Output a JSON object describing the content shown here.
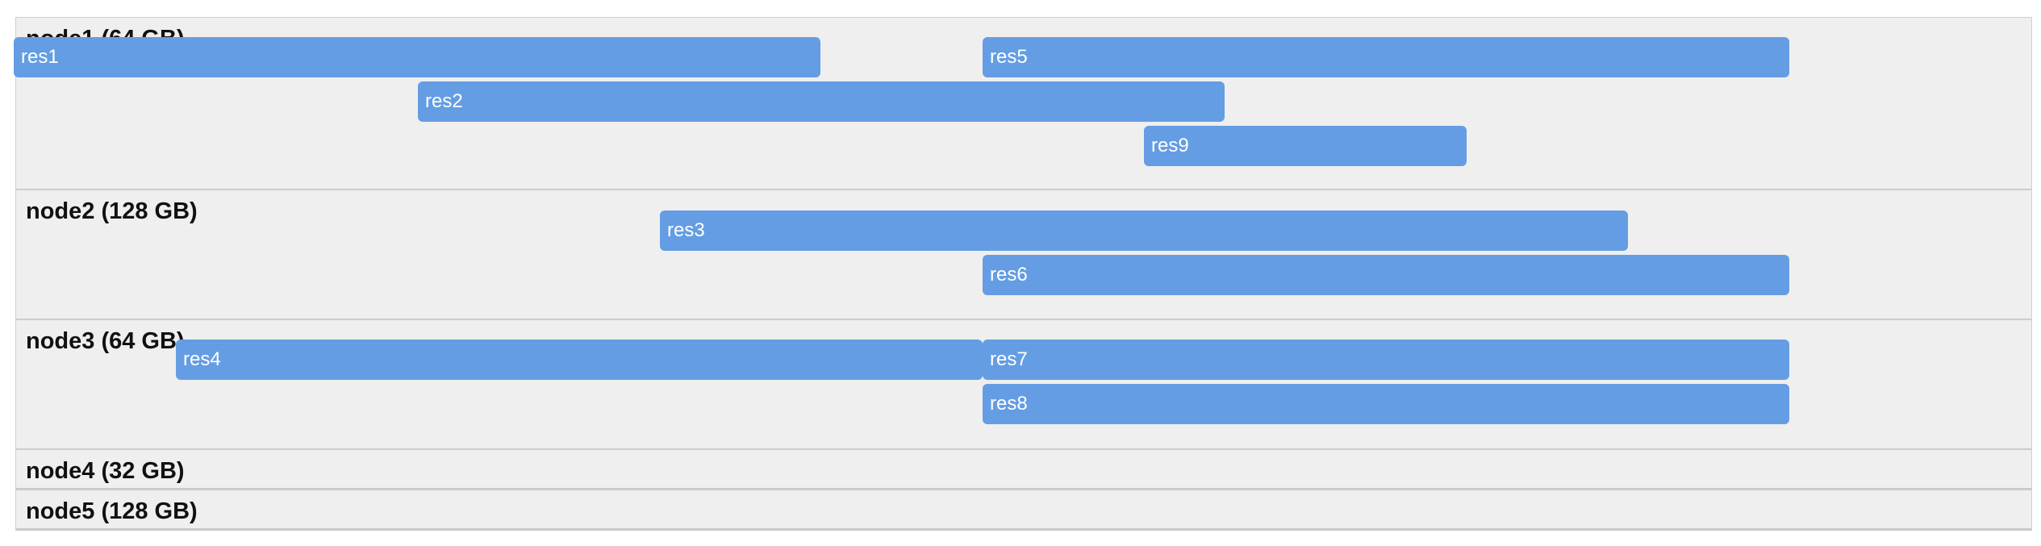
{
  "timeline": {
    "groups": [
      {
        "id": "node1",
        "label": "node1 (64 GB)"
      },
      {
        "id": "node2",
        "label": "node2 (128 GB)"
      },
      {
        "id": "node3",
        "label": "node3 (64 GB)"
      },
      {
        "id": "node4",
        "label": "node4 (32 GB)"
      },
      {
        "id": "node5",
        "label": "node5 (128 GB)"
      }
    ],
    "items": [
      {
        "id": "res1",
        "label": "res1",
        "group": "node1"
      },
      {
        "id": "res5",
        "label": "res5",
        "group": "node1"
      },
      {
        "id": "res2",
        "label": "res2",
        "group": "node1"
      },
      {
        "id": "res9",
        "label": "res9",
        "group": "node1"
      },
      {
        "id": "res3",
        "label": "res3",
        "group": "node2"
      },
      {
        "id": "res6",
        "label": "res6",
        "group": "node2"
      },
      {
        "id": "res4",
        "label": "res4",
        "group": "node3"
      },
      {
        "id": "res7",
        "label": "res7",
        "group": "node3"
      },
      {
        "id": "res8",
        "label": "res8",
        "group": "node3"
      }
    ]
  },
  "colors": {
    "item_fill": "#649de3",
    "item_text": "#ffffff",
    "group_background": "#efefef",
    "group_border": "#cfcfcf",
    "group_label_text": "#111111"
  }
}
